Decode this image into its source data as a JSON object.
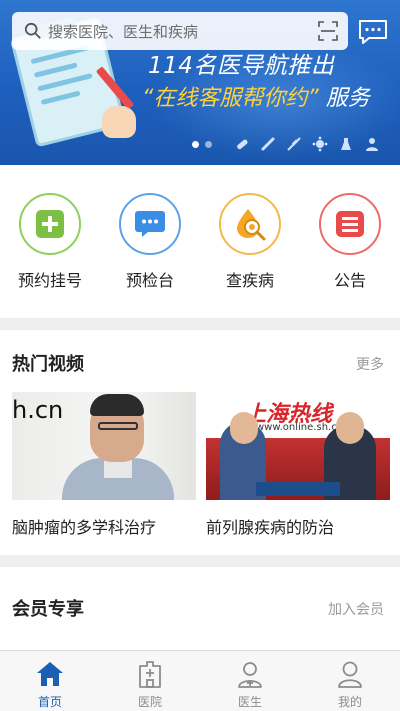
{
  "search": {
    "placeholder": "搜索医院、医生和疾病"
  },
  "banner": {
    "title": "114名医导航推出",
    "subtitle_highlight": "“在线客服帮你约”",
    "subtitle_rest": "服务",
    "carousel_active_index": 0,
    "carousel_count": 2
  },
  "quick_actions": [
    {
      "label": "预约挂号",
      "icon": "plus-icon",
      "color": "#7bc043"
    },
    {
      "label": "预检台",
      "icon": "chat-icon",
      "color": "#3a8ee6"
    },
    {
      "label": "查疾病",
      "icon": "virus-search-icon",
      "color": "#f5a623"
    },
    {
      "label": "公告",
      "icon": "list-icon",
      "color": "#e94b4b"
    }
  ],
  "hot_videos": {
    "title": "热门视频",
    "more": "更多",
    "items": [
      {
        "title": "脑肿瘤的多学科治疗",
        "thumb_text": "h.cn"
      },
      {
        "title": "前列腺疾病的防治",
        "thumb_brand": "上海热线",
        "thumb_url": "www.online.sh.cn"
      }
    ]
  },
  "members": {
    "title": "会员专享",
    "action": "加入会员"
  },
  "tabs": [
    {
      "label": "首页",
      "icon": "home-icon",
      "active": true
    },
    {
      "label": "医院",
      "icon": "hospital-icon",
      "active": false
    },
    {
      "label": "医生",
      "icon": "doctor-icon",
      "active": false
    },
    {
      "label": "我的",
      "icon": "user-icon",
      "active": false
    }
  ],
  "colors": {
    "primary": "#1a5fb4",
    "banner_blue": "#1e5fbd"
  }
}
